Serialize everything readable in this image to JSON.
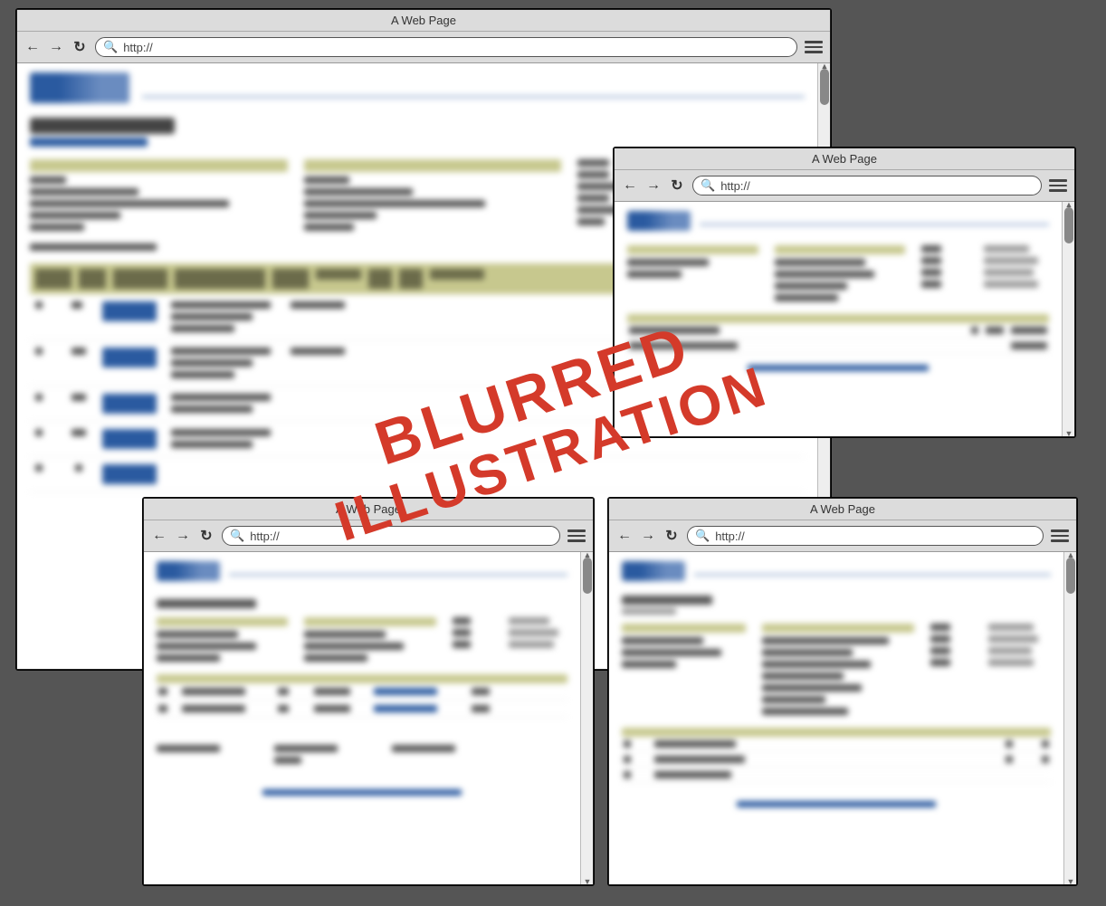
{
  "stamp": {
    "line1": "BLURRED",
    "line2": "ILLUSTRATION"
  },
  "windows": [
    {
      "id": "w1",
      "title": "A Web Page",
      "url": "http://"
    },
    {
      "id": "w2",
      "title": "A Web Page",
      "url": "http://"
    },
    {
      "id": "w3",
      "title": "A Web Page",
      "url": "http://"
    },
    {
      "id": "w4",
      "title": "A Web Page",
      "url": "http://"
    }
  ],
  "page_main": {
    "heading": "Order Details",
    "sublink": "Order Status Search",
    "sections": [
      "Bill To",
      "Ship To"
    ],
    "table_headers": [
      "Quote Line #",
      "Qty",
      "Product Name",
      "Product Desc",
      "CM",
      "Ext Part",
      "Unit",
      "Ship",
      "Ordered"
    ]
  }
}
